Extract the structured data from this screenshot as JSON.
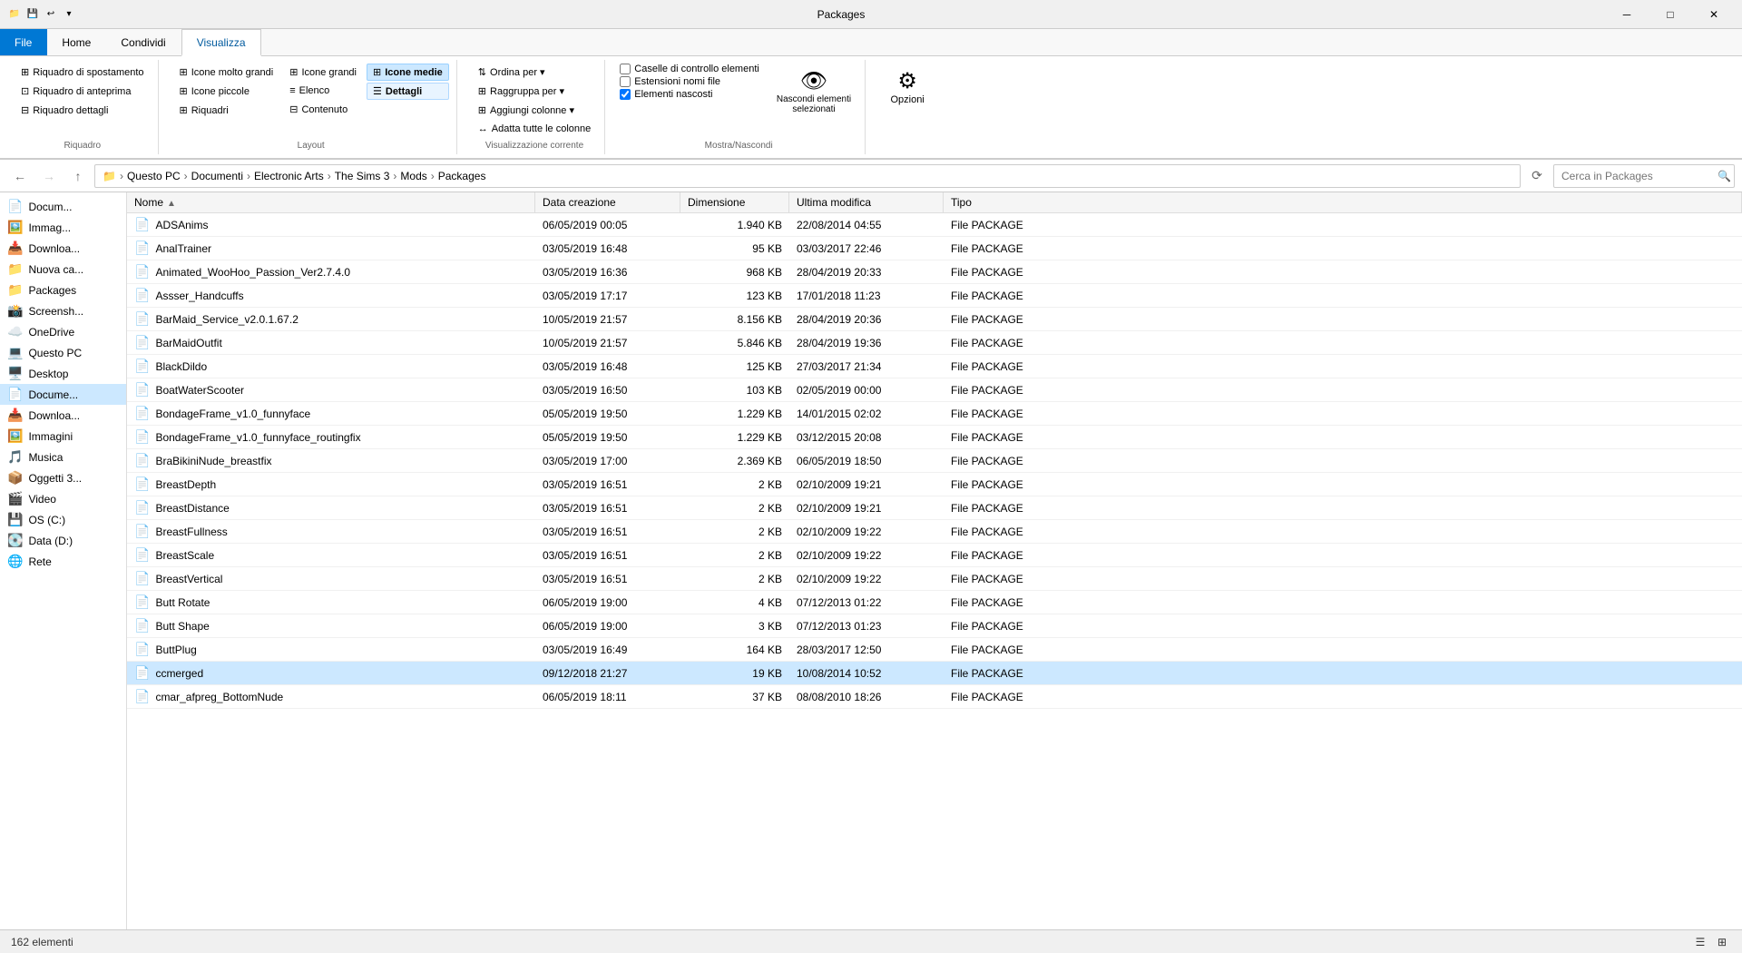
{
  "titlebar": {
    "title": "Packages",
    "minimize_label": "─",
    "maximize_label": "□",
    "close_label": "✕"
  },
  "ribbon": {
    "tabs": [
      "File",
      "Home",
      "Condividi",
      "Visualizza"
    ],
    "active_tab": "Visualizza",
    "groups": {
      "riquadro": {
        "label": "Riquadro",
        "items": [
          "Riquadro di spostamento",
          "Riquadro di anteprima",
          "Riquadro dettagli"
        ]
      },
      "layout": {
        "label": "Layout",
        "items": [
          "Icone molto grandi",
          "Icone grandi",
          "Icone medie",
          "Icone piccole",
          "Elenco",
          "Dettagli",
          "Riquadri",
          "Contenuto"
        ]
      },
      "visualizzazione_corrente": {
        "label": "Visualizzazione corrente",
        "items": [
          "Ordina per ▾",
          "Raggruppa per ▾",
          "Aggiungi colonne ▾",
          "Adatta tutte le colonne"
        ]
      },
      "mostra_nascondi": {
        "label": "Mostra/Nascondi",
        "items": [
          "Caselle di controllo elementi",
          "Estensioni nomi file",
          "Elementi nascosti"
        ],
        "checked": [
          false,
          false,
          true
        ]
      },
      "nascondi": {
        "label": "",
        "items": [
          "Nascondi elementi selezionati"
        ]
      },
      "opzioni": {
        "label": "",
        "items": [
          "Opzioni"
        ]
      }
    }
  },
  "addressbar": {
    "back_disabled": false,
    "forward_disabled": true,
    "up_disabled": false,
    "path_segments": [
      "Questo PC",
      "Documenti",
      "Electronic Arts",
      "The Sims 3",
      "Mods",
      "Packages"
    ],
    "search_placeholder": "Cerca in Packages"
  },
  "sidebar": {
    "items": [
      {
        "icon": "📄",
        "label": "Docum...",
        "selected": false
      },
      {
        "icon": "🖼️",
        "label": "Immag...",
        "selected": false
      },
      {
        "icon": "📁",
        "label": "Downloa...",
        "selected": false
      },
      {
        "icon": "📁",
        "label": "Nuova ca...",
        "selected": false
      },
      {
        "icon": "📁",
        "label": "Packages",
        "selected": false
      },
      {
        "icon": "📸",
        "label": "Screensh...",
        "selected": false
      },
      {
        "icon": "☁️",
        "label": "OneDrive",
        "selected": false
      },
      {
        "icon": "💻",
        "label": "Questo PC",
        "selected": false
      },
      {
        "icon": "🖥️",
        "label": "Desktop",
        "selected": false
      },
      {
        "icon": "📄",
        "label": "Docume...",
        "selected": true
      },
      {
        "icon": "📥",
        "label": "Downloa...",
        "selected": false
      },
      {
        "icon": "🖼️",
        "label": "Immagini",
        "selected": false
      },
      {
        "icon": "🎵",
        "label": "Musica",
        "selected": false
      },
      {
        "icon": "📦",
        "label": "Oggetti 3...",
        "selected": false
      },
      {
        "icon": "🎬",
        "label": "Video",
        "selected": false
      },
      {
        "icon": "💾",
        "label": "OS (C:)",
        "selected": false
      },
      {
        "icon": "💽",
        "label": "Data (D:)",
        "selected": false
      },
      {
        "icon": "🌐",
        "label": "Rete",
        "selected": false
      }
    ]
  },
  "filelist": {
    "columns": [
      {
        "label": "Nome",
        "key": "name"
      },
      {
        "label": "Data creazione",
        "key": "created"
      },
      {
        "label": "Dimensione",
        "key": "size"
      },
      {
        "label": "Ultima modifica",
        "key": "modified"
      },
      {
        "label": "Tipo",
        "key": "type"
      }
    ],
    "rows": [
      {
        "name": "ADSAnims",
        "created": "06/05/2019 00:05",
        "size": "1.940 KB",
        "modified": "22/08/2014 04:55",
        "type": "File PACKAGE"
      },
      {
        "name": "AnalTrainer",
        "created": "03/05/2019 16:48",
        "size": "95 KB",
        "modified": "03/03/2017 22:46",
        "type": "File PACKAGE"
      },
      {
        "name": "Animated_WooHoo_Passion_Ver2.7.4.0",
        "created": "03/05/2019 16:36",
        "size": "968 KB",
        "modified": "28/04/2019 20:33",
        "type": "File PACKAGE"
      },
      {
        "name": "Assser_Handcuffs",
        "created": "03/05/2019 17:17",
        "size": "123 KB",
        "modified": "17/01/2018 11:23",
        "type": "File PACKAGE"
      },
      {
        "name": "BarMaid_Service_v2.0.1.67.2",
        "created": "10/05/2019 21:57",
        "size": "8.156 KB",
        "modified": "28/04/2019 20:36",
        "type": "File PACKAGE"
      },
      {
        "name": "BarMaidOutfit",
        "created": "10/05/2019 21:57",
        "size": "5.846 KB",
        "modified": "28/04/2019 19:36",
        "type": "File PACKAGE"
      },
      {
        "name": "BlackDildo",
        "created": "03/05/2019 16:48",
        "size": "125 KB",
        "modified": "27/03/2017 21:34",
        "type": "File PACKAGE"
      },
      {
        "name": "BoatWaterScooter",
        "created": "03/05/2019 16:50",
        "size": "103 KB",
        "modified": "02/05/2019 00:00",
        "type": "File PACKAGE"
      },
      {
        "name": "BondageFrame_v1.0_funnyface",
        "created": "05/05/2019 19:50",
        "size": "1.229 KB",
        "modified": "14/01/2015 02:02",
        "type": "File PACKAGE"
      },
      {
        "name": "BondageFrame_v1.0_funnyface_routingfix",
        "created": "05/05/2019 19:50",
        "size": "1.229 KB",
        "modified": "03/12/2015 20:08",
        "type": "File PACKAGE"
      },
      {
        "name": "BraBikiniNude_breastfix",
        "created": "03/05/2019 17:00",
        "size": "2.369 KB",
        "modified": "06/05/2019 18:50",
        "type": "File PACKAGE"
      },
      {
        "name": "BreastDepth",
        "created": "03/05/2019 16:51",
        "size": "2 KB",
        "modified": "02/10/2009 19:21",
        "type": "File PACKAGE"
      },
      {
        "name": "BreastDistance",
        "created": "03/05/2019 16:51",
        "size": "2 KB",
        "modified": "02/10/2009 19:21",
        "type": "File PACKAGE"
      },
      {
        "name": "BreastFullness",
        "created": "03/05/2019 16:51",
        "size": "2 KB",
        "modified": "02/10/2009 19:22",
        "type": "File PACKAGE"
      },
      {
        "name": "BreastScale",
        "created": "03/05/2019 16:51",
        "size": "2 KB",
        "modified": "02/10/2009 19:22",
        "type": "File PACKAGE"
      },
      {
        "name": "BreastVertical",
        "created": "03/05/2019 16:51",
        "size": "2 KB",
        "modified": "02/10/2009 19:22",
        "type": "File PACKAGE"
      },
      {
        "name": "Butt Rotate",
        "created": "06/05/2019 19:00",
        "size": "4 KB",
        "modified": "07/12/2013 01:22",
        "type": "File PACKAGE"
      },
      {
        "name": "Butt Shape",
        "created": "06/05/2019 19:00",
        "size": "3 KB",
        "modified": "07/12/2013 01:23",
        "type": "File PACKAGE"
      },
      {
        "name": "ButtPlug",
        "created": "03/05/2019 16:49",
        "size": "164 KB",
        "modified": "28/03/2017 12:50",
        "type": "File PACKAGE"
      },
      {
        "name": "ccmerged",
        "created": "09/12/2018 21:27",
        "size": "19 KB",
        "modified": "10/08/2014 10:52",
        "type": "File PACKAGE"
      },
      {
        "name": "cmar_afpreg_BottomNude",
        "created": "06/05/2019 18:11",
        "size": "37 KB",
        "modified": "08/08/2010 18:26",
        "type": "File PACKAGE"
      }
    ],
    "selected_row": 19
  },
  "statusbar": {
    "count_label": "162 elementi"
  }
}
